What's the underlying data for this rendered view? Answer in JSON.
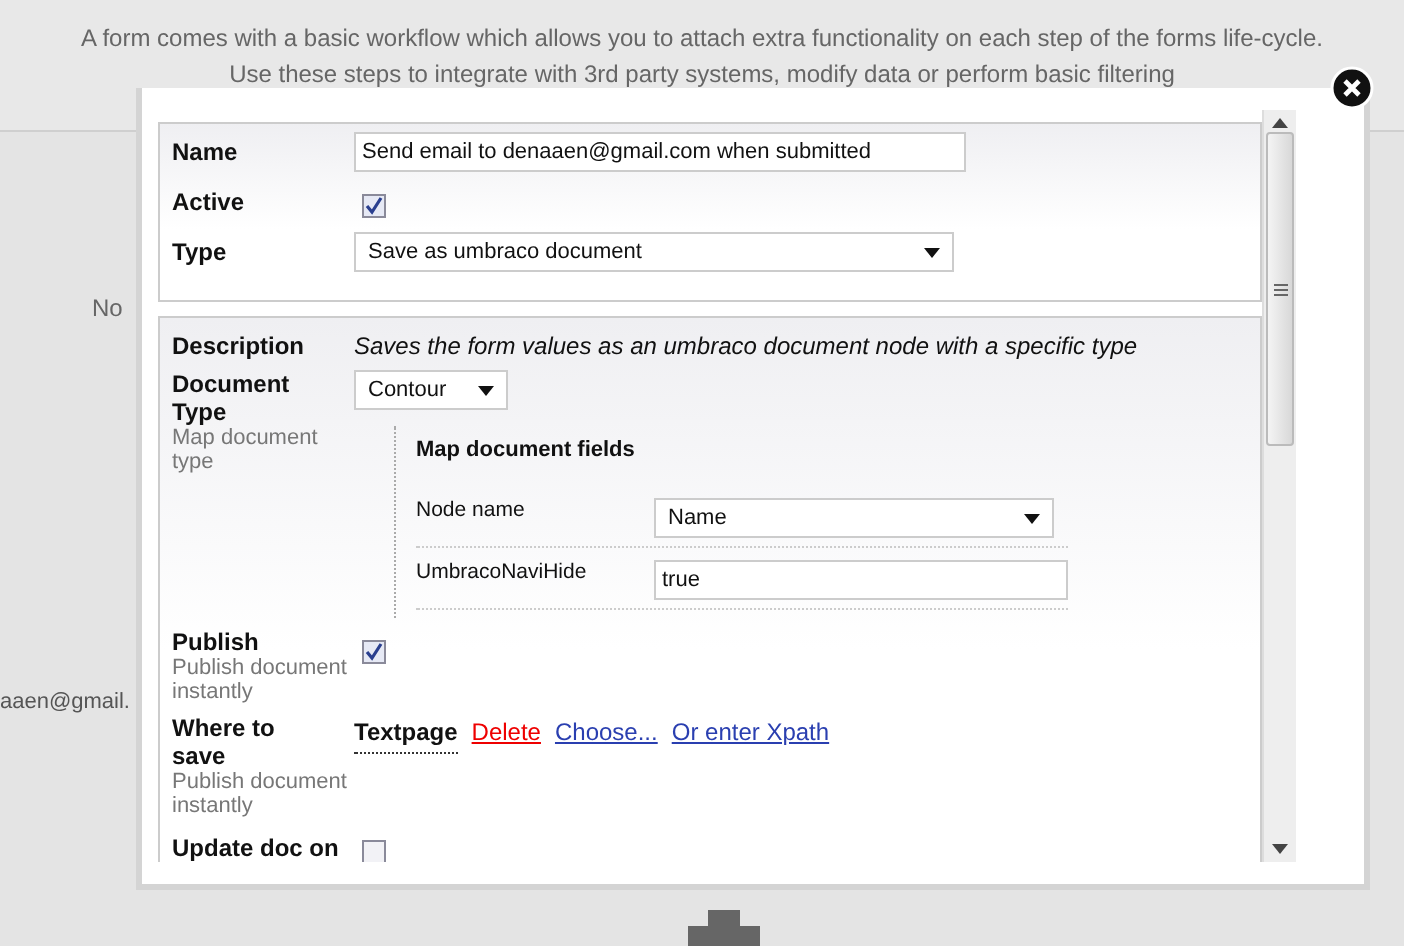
{
  "page": {
    "intro": [
      "A form comes with a basic workflow which allows you to attach extra functionality on each step of the forms life-cycle.",
      "Use these steps to integrate with 3rd party systems, modify data or perform basic filtering"
    ],
    "fragments": [
      "No",
      "aaen@gmail."
    ]
  },
  "dialog": {
    "general": [
      {
        "kind": "text",
        "label": "Name",
        "value": "Send email to denaaen@gmail.com when submitted"
      },
      {
        "kind": "checkbox",
        "label": "Active",
        "checked": true
      },
      {
        "kind": "select",
        "label": "Type",
        "value": "Save as umbraco document"
      }
    ],
    "description": {
      "label": "Description",
      "text": "Saves the form values as an umbraco document node with a specific type"
    },
    "document_type": {
      "label": "Document Type",
      "hint": "Map document type",
      "value": "Contour"
    },
    "mapping": {
      "title": "Map document fields",
      "rows": [
        {
          "kind": "select",
          "label": "Node name",
          "value": "Name"
        },
        {
          "kind": "text",
          "label": "UmbracoNaviHide",
          "value": "true"
        }
      ]
    },
    "publish": {
      "label": "Publish",
      "hint": "Publish document instantly",
      "checked": true
    },
    "where_to_save": {
      "label": "Where to save",
      "hint": "Publish document instantly",
      "node": "Textpage",
      "links": [
        {
          "kind": "danger",
          "label": "Delete"
        },
        {
          "kind": "link",
          "label": "Choose..."
        },
        {
          "kind": "link",
          "label": "Or enter Xpath"
        }
      ]
    },
    "update_doc": {
      "label": "Update doc on",
      "checked": false
    }
  }
}
